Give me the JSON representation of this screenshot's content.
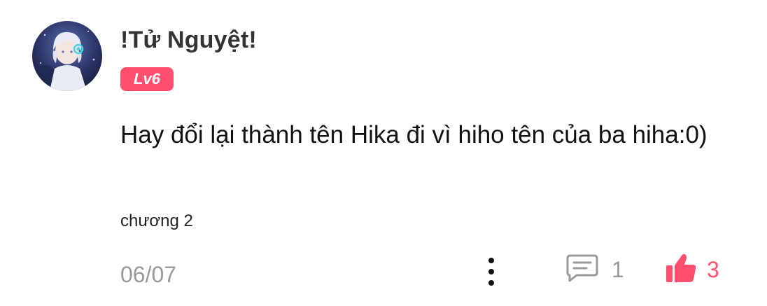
{
  "comment": {
    "username": "!Tử Nguyệt!",
    "level_badge": "Lv6",
    "text": "Hay đổi lại thành tên Hika đi vì hiho tên của ba hiha:0)",
    "chapter": "chương 2",
    "date": "06/07",
    "reply_count": "1",
    "like_count": "3"
  },
  "icons": {
    "more": "more-vertical-icon",
    "reply": "comment-icon",
    "like": "thumbs-up-icon"
  },
  "colors": {
    "accent": "#ff4f6e",
    "muted": "#9a9a9a",
    "text": "#111111"
  }
}
